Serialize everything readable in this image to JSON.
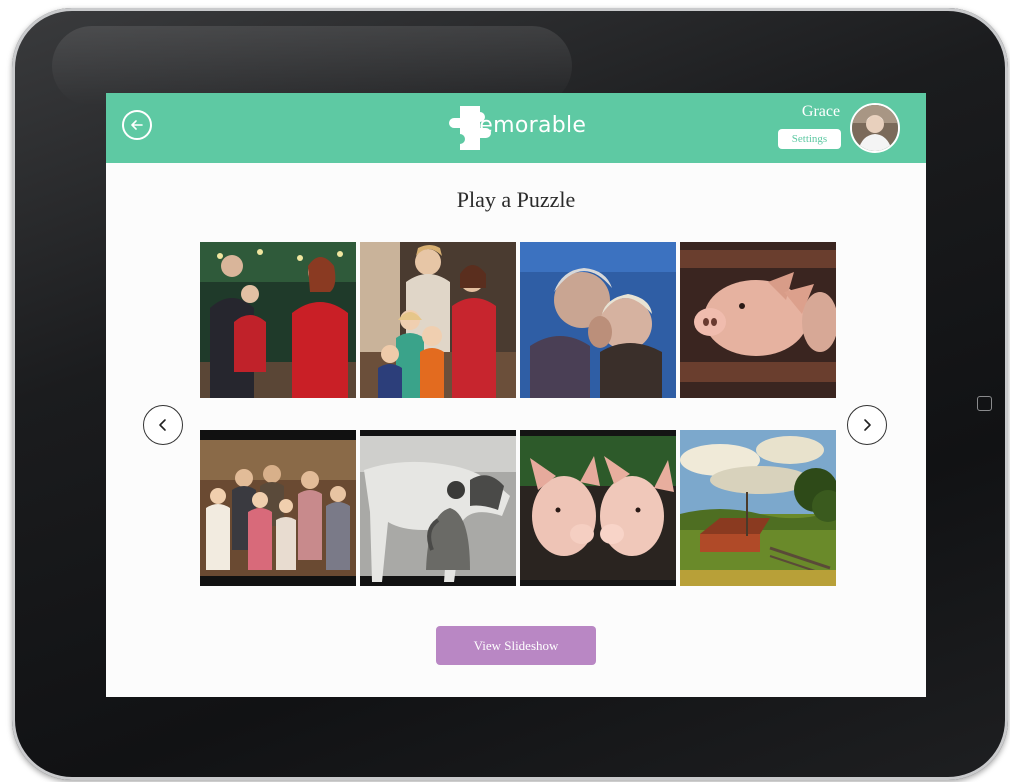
{
  "header": {
    "app_name": "Memorable",
    "user_name": "Grace",
    "settings_label": "Settings",
    "background_color": "#5ec9a3"
  },
  "main": {
    "title": "Play a Puzzle",
    "slideshow_label": "View Slideshow",
    "slideshow_color": "#b987c4",
    "photos": [
      {
        "subject": "family with child and holiday decorations"
      },
      {
        "subject": "grandmother with children"
      },
      {
        "subject": "elderly couple embracing"
      },
      {
        "subject": "pig looking through fence"
      },
      {
        "subject": "vintage family portrait"
      },
      {
        "subject": "woman milking cow"
      },
      {
        "subject": "two pigs"
      },
      {
        "subject": "red barn in countryside"
      }
    ]
  },
  "icons": {
    "back": "back-arrow-icon",
    "prev": "chevron-left-icon",
    "next": "chevron-right-icon"
  }
}
